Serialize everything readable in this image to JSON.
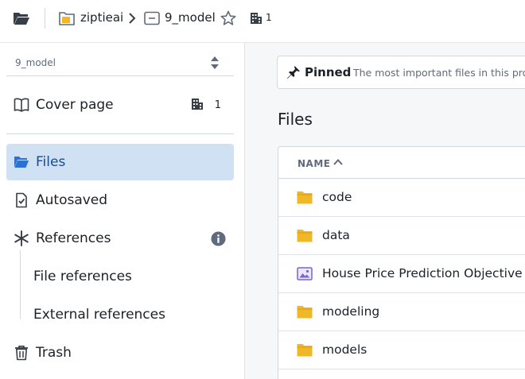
{
  "topbar": {
    "folder_button": "open-folder",
    "breadcrumb": [
      {
        "label": "ziptieai",
        "icon": "project-folder-icon"
      },
      {
        "label": "9_model",
        "icon": "compass-project-icon"
      }
    ],
    "favorite_icon": "star-outline",
    "org_count": "1"
  },
  "sidebar": {
    "project_name": "9_model",
    "items": [
      {
        "label": "Cover page",
        "icon": "book-icon",
        "badge": "1"
      },
      {
        "label": "Files",
        "icon": "folder-open-icon",
        "active": true
      },
      {
        "label": "Autosaved",
        "icon": "document-check-icon"
      },
      {
        "label": "References",
        "icon": "asterisk-icon",
        "info": true
      },
      {
        "label": "File references",
        "sub": true
      },
      {
        "label": "External references",
        "sub": true
      },
      {
        "label": "Trash",
        "icon": "trash-icon"
      }
    ]
  },
  "main": {
    "pinned": {
      "title": "Pinned",
      "description": "The most important files in this proje"
    },
    "section_title": "Files",
    "table": {
      "column_name": "NAME",
      "rows": [
        {
          "label": "code",
          "type": "folder"
        },
        {
          "label": "data",
          "type": "folder"
        },
        {
          "label": "House Price Prediction Objective",
          "type": "image"
        },
        {
          "label": "modeling",
          "type": "folder"
        },
        {
          "label": "models",
          "type": "folder"
        }
      ]
    }
  },
  "colors": {
    "active_bg": "#d1e1f4",
    "active_text": "#184a90",
    "folder_yellow": "#f0b726",
    "image_purple": "#7961db"
  }
}
